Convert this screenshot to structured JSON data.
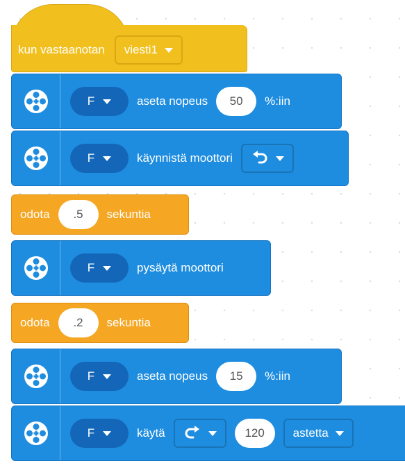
{
  "hat_block": {
    "label": "kun vastaanotan",
    "message": "viesti1"
  },
  "blocks": [
    {
      "type": "motor",
      "port": "F",
      "text": "aseta nopeus",
      "value": "50",
      "suffix": "%:iin"
    },
    {
      "type": "motor",
      "port": "F",
      "text": "käynnistä moottori",
      "direction_icon": "counterclockwise-arrow-icon"
    },
    {
      "type": "wait",
      "prefix": "odota",
      "value": ".5",
      "suffix": "sekuntia"
    },
    {
      "type": "motor",
      "port": "F",
      "text": "pysäytä moottori"
    },
    {
      "type": "wait",
      "prefix": "odota",
      "value": ".2",
      "suffix": "sekuntia"
    },
    {
      "type": "motor",
      "port": "F",
      "text": "aseta nopeus",
      "value": "15",
      "suffix": "%:iin"
    },
    {
      "type": "motor",
      "port": "F",
      "text": "käytä",
      "direction_icon": "clockwise-arrow-icon",
      "value": "120",
      "unit": "astetta"
    }
  ],
  "colors": {
    "event": "#f2c01e",
    "motor": "#1e8de0",
    "control": "#f5a623"
  }
}
